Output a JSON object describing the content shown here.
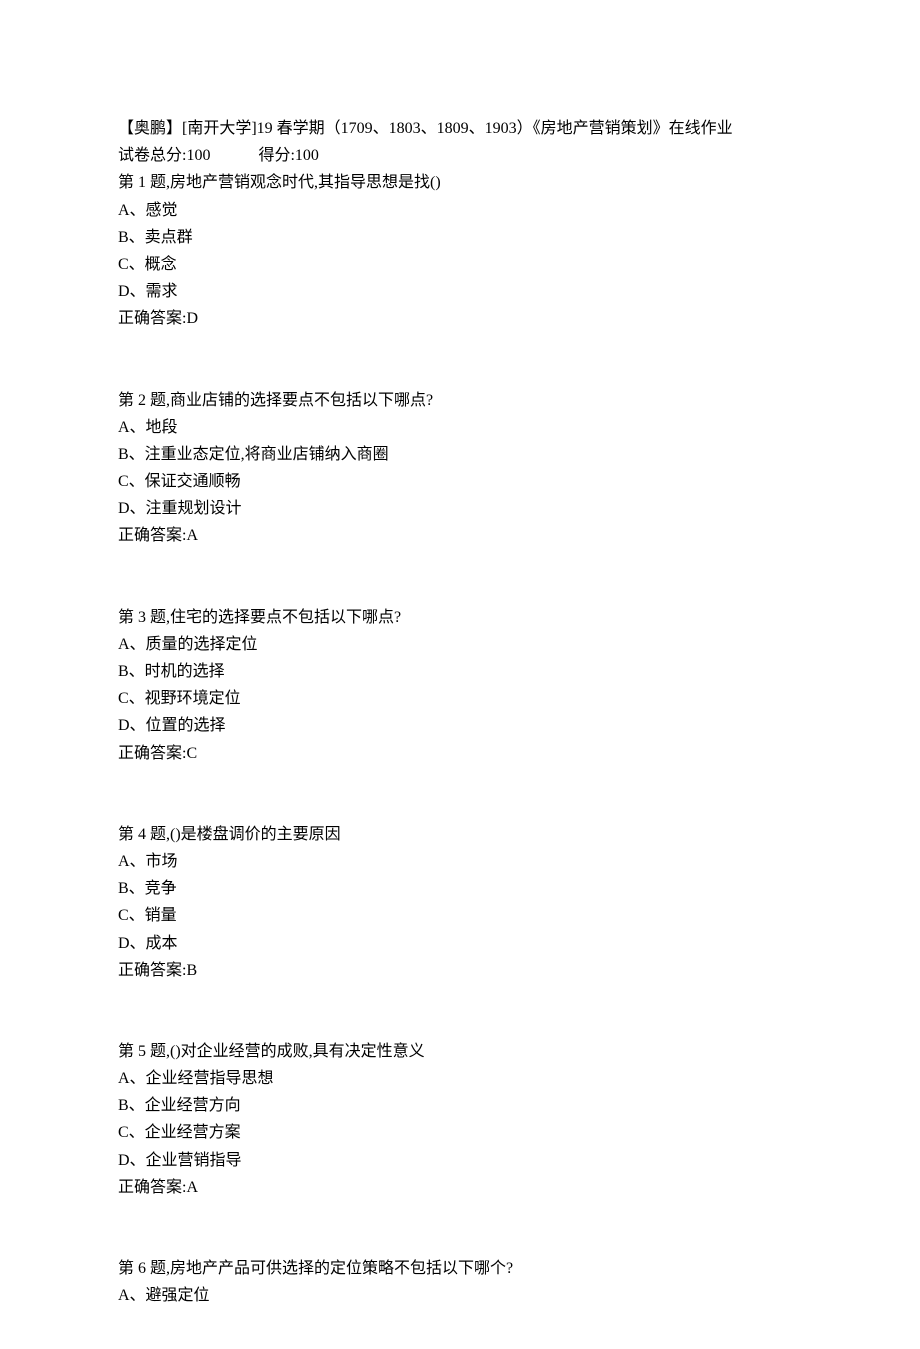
{
  "header": {
    "title": "【奥鹏】[南开大学]19 春学期（1709、1803、1809、1903）《房地产营销策划》在线作业",
    "total_label": "试卷总分:100",
    "score_label": "得分:100"
  },
  "questions": [
    {
      "stem": "第 1 题,房地产营销观念时代,其指导思想是找()",
      "options": [
        "A、感觉",
        "B、卖点群",
        "C、概念",
        "D、需求"
      ],
      "answer": "正确答案:D"
    },
    {
      "stem": "第 2 题,商业店铺的选择要点不包括以下哪点?",
      "options": [
        "A、地段",
        "B、注重业态定位,将商业店铺纳入商圈",
        "C、保证交通顺畅",
        "D、注重规划设计"
      ],
      "answer": "正确答案:A"
    },
    {
      "stem": "第 3 题,住宅的选择要点不包括以下哪点?",
      "options": [
        "A、质量的选择定位",
        "B、时机的选择",
        "C、视野环境定位",
        "D、位置的选择"
      ],
      "answer": "正确答案:C"
    },
    {
      "stem": "第 4 题,()是楼盘调价的主要原因",
      "options": [
        "A、市场",
        "B、竞争",
        "C、销量",
        "D、成本"
      ],
      "answer": "正确答案:B"
    },
    {
      "stem": "第 5 题,()对企业经营的成败,具有决定性意义",
      "options": [
        "A、企业经营指导思想",
        "B、企业经营方向",
        "C、企业经营方案",
        "D、企业营销指导"
      ],
      "answer": "正确答案:A"
    },
    {
      "stem": "第 6 题,房地产产品可供选择的定位策略不包括以下哪个?",
      "options": [
        "A、避强定位"
      ],
      "answer": ""
    }
  ]
}
